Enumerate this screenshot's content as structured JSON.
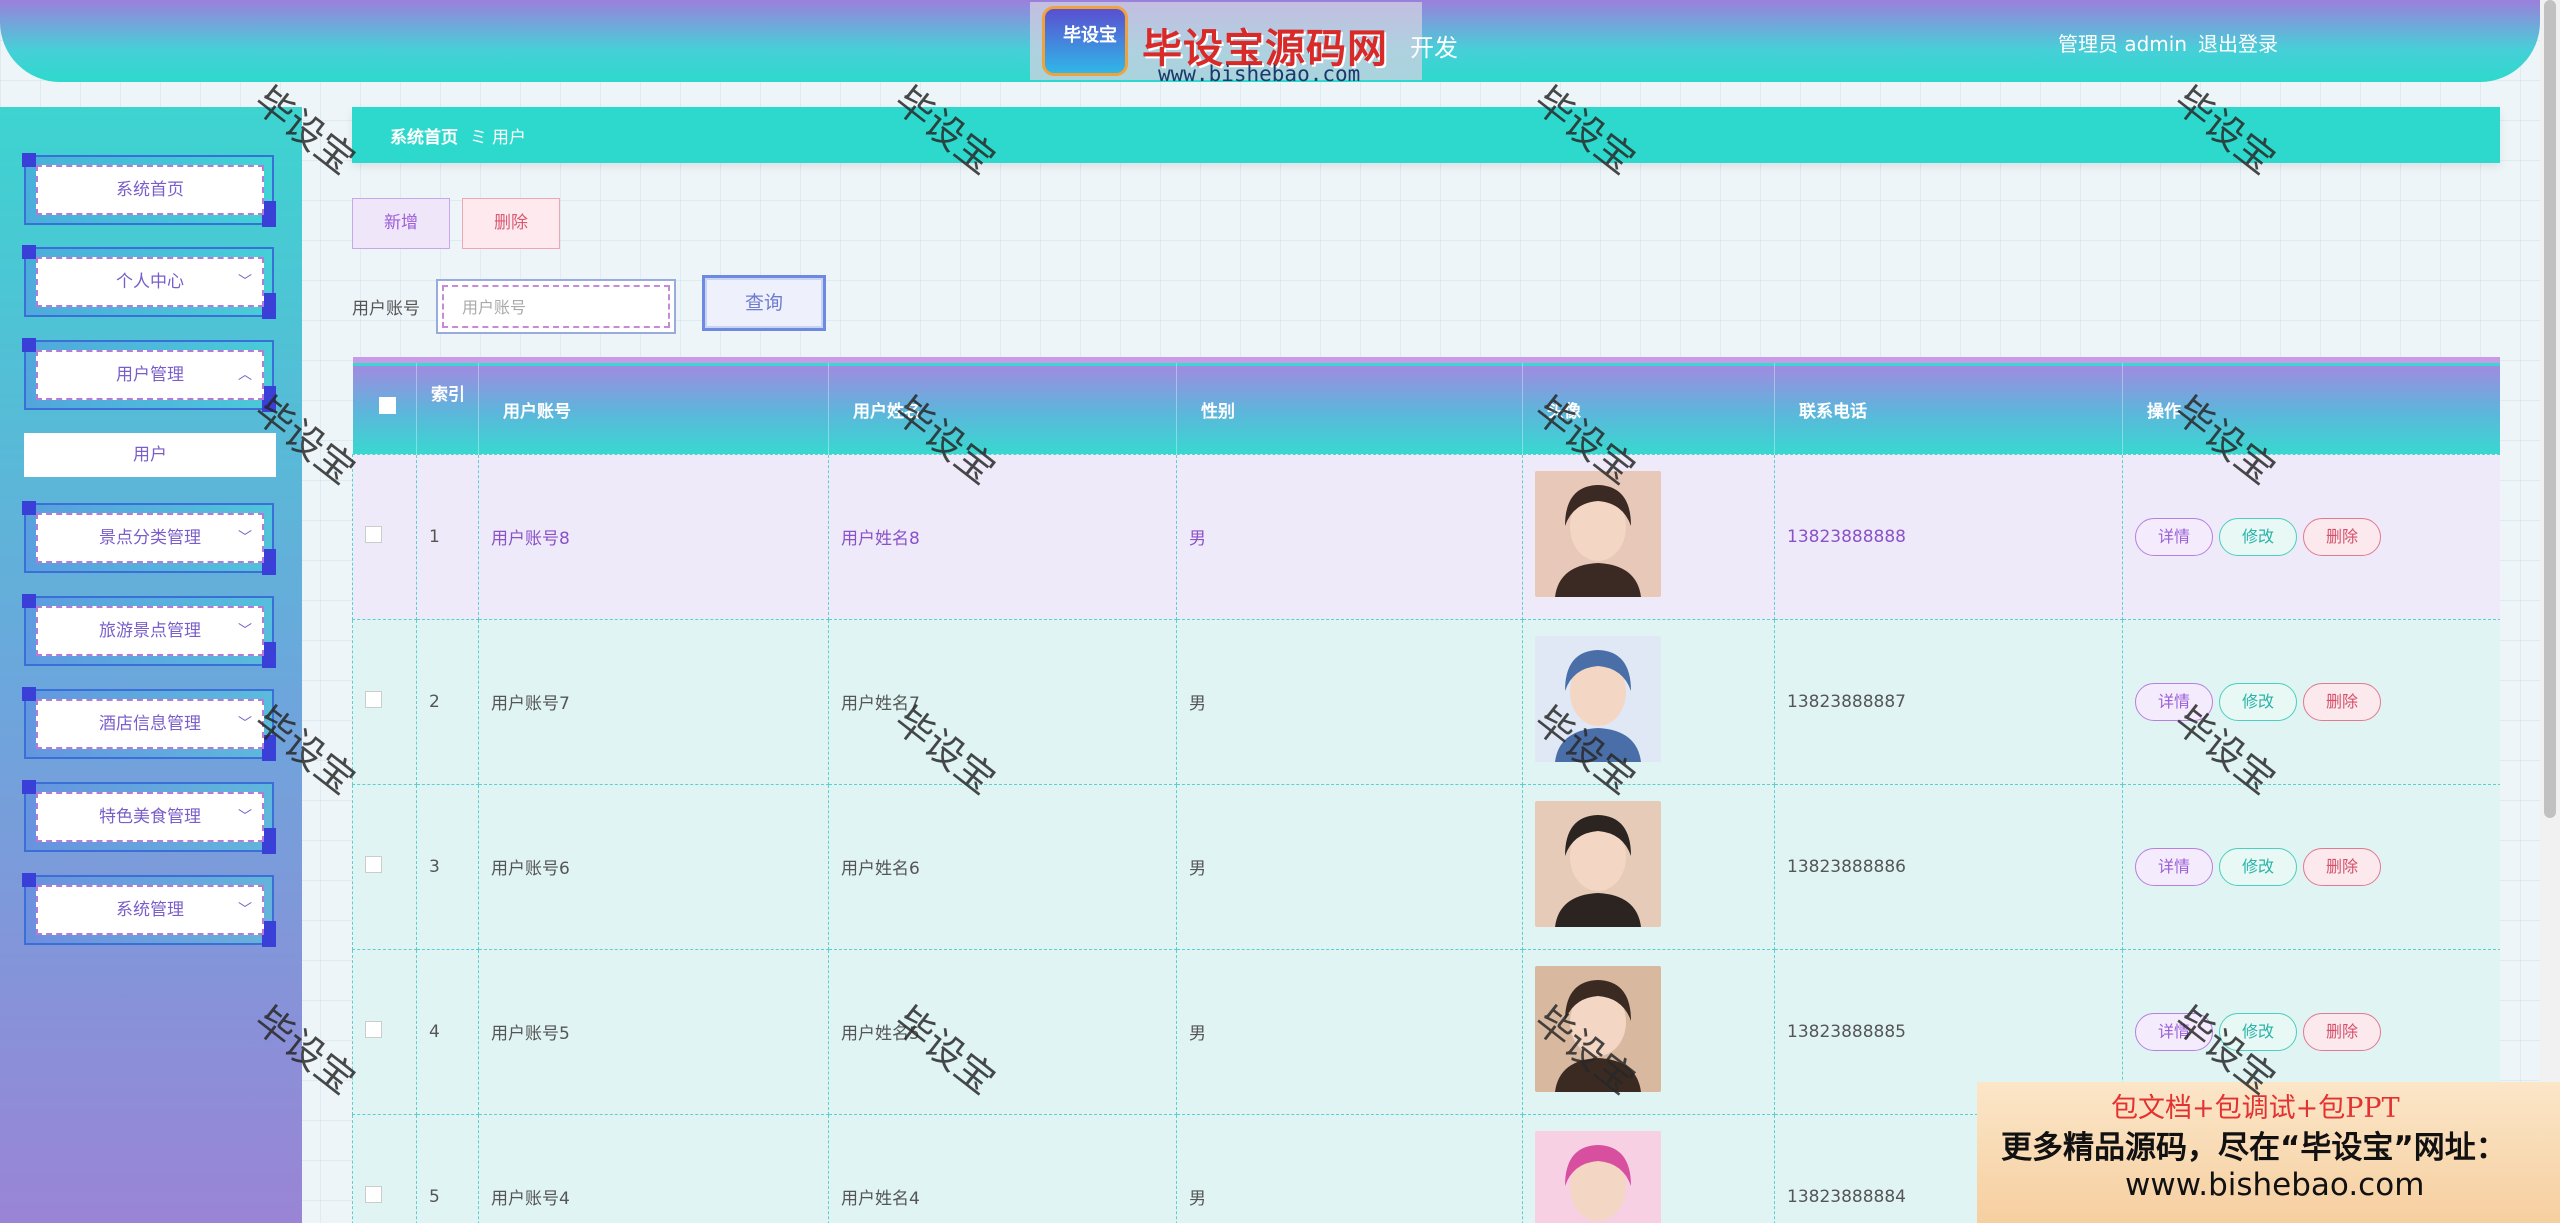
{
  "header": {
    "badge_text": "毕设宝",
    "logo_title": "毕设宝源码网",
    "logo_url": "www.bishebao.com",
    "title_suffix": "开发",
    "user_label": "管理员 admin",
    "logout_label": "退出登录"
  },
  "sidebar": {
    "items": [
      {
        "label": "系统首页"
      },
      {
        "label": "个人中心"
      },
      {
        "label": "用户管理"
      },
      {
        "label": "景点分类管理"
      },
      {
        "label": "旅游景点管理"
      },
      {
        "label": "酒店信息管理"
      },
      {
        "label": "特色美食管理"
      },
      {
        "label": "系统管理"
      }
    ],
    "submenu": {
      "label": "用户"
    }
  },
  "breadcrumb": {
    "home": "系统首页",
    "separator": "ミ",
    "current": "用户"
  },
  "actions": {
    "add_label": "新增",
    "delete_label": "删除"
  },
  "search": {
    "label": "用户账号",
    "placeholder": "用户账号",
    "button": "查询"
  },
  "table": {
    "headers": {
      "index": "索引",
      "account": "用户账号",
      "name": "用户姓名",
      "gender": "性别",
      "avatar": "头像",
      "phone": "联系电话",
      "ops": "操作"
    },
    "rows": [
      {
        "index": "1",
        "account": "用户账号8",
        "name": "用户姓名8",
        "gender": "男",
        "phone": "13823888888"
      },
      {
        "index": "2",
        "account": "用户账号7",
        "name": "用户姓名7",
        "gender": "男",
        "phone": "13823888887"
      },
      {
        "index": "3",
        "account": "用户账号6",
        "name": "用户姓名6",
        "gender": "男",
        "phone": "13823888886"
      },
      {
        "index": "4",
        "account": "用户账号5",
        "name": "用户姓名5",
        "gender": "男",
        "phone": "13823888885"
      },
      {
        "index": "5",
        "account": "用户账号4",
        "name": "用户姓名4",
        "gender": "男",
        "phone": "13823888884"
      }
    ],
    "op_labels": {
      "detail": "详情",
      "edit": "修改",
      "remove": "删除"
    }
  },
  "promo": {
    "line1": "包文档+包调试+包PPT",
    "line2": "更多精品源码，尽在“毕设宝”网址：",
    "line3": "www.bishebao.com"
  },
  "watermark": "毕设宝",
  "colors": {
    "accent_teal": "#2dd9cc",
    "accent_purple": "#9b7fdc",
    "add_button": "#9b5fd8",
    "delete_button": "#d85a72"
  }
}
